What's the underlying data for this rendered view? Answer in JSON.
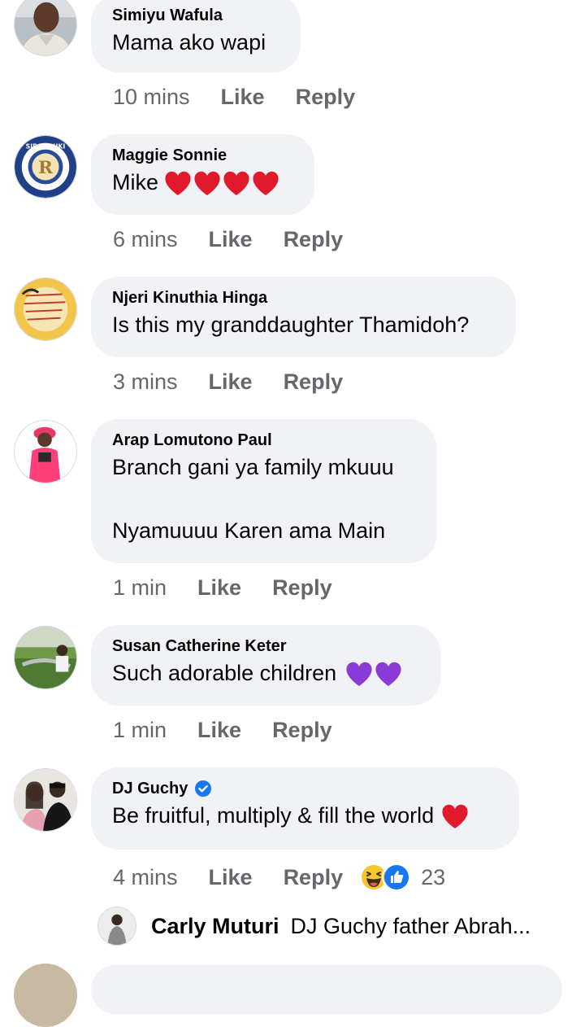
{
  "comments": [
    {
      "name": "Simiyu Wafula",
      "text": "Mama ako wapi",
      "time": "10 mins",
      "like": "Like",
      "reply": "Reply"
    },
    {
      "name": "Maggie Sonnie",
      "text": "Mike",
      "time": "6 mins",
      "like": "Like",
      "reply": "Reply",
      "emoji": "red-heart x4"
    },
    {
      "name": "Njeri Kinuthia Hinga",
      "text": "Is this my granddaughter Thamidoh?",
      "time": "3 mins",
      "like": "Like",
      "reply": "Reply"
    },
    {
      "name": "Arap Lomutono Paul",
      "text_line1": "Branch gani ya family mkuuu",
      "text_line2": "Nyamuuuu Karen ama Main",
      "time": "1 min",
      "like": "Like",
      "reply": "Reply"
    },
    {
      "name": "Susan Catherine Keter",
      "text": "Such adorable children",
      "time": "1 min",
      "like": "Like",
      "reply": "Reply",
      "emoji": "purple-heart x2"
    },
    {
      "name": "DJ Guchy",
      "verified": true,
      "text": "Be fruitful, multiply & fill the world",
      "time": "4 mins",
      "like": "Like",
      "reply": "Reply",
      "emoji": "red-heart",
      "reaction_count": "23",
      "reactions": [
        "haha",
        "like"
      ]
    }
  ],
  "reply_preview": {
    "name": "Carly Muturi",
    "text": "DJ Guchy father Abrah..."
  },
  "avatar_texts": {
    "sibanduki": "SIBANDUKI",
    "sibanduki_letter": "R"
  },
  "colors": {
    "bubble": "#f0f2f5",
    "meta": "#65676b",
    "text": "#050505",
    "heart_red": "#e0192b",
    "heart_purple": "#8a3ad6",
    "verified_blue": "#1877f2"
  }
}
